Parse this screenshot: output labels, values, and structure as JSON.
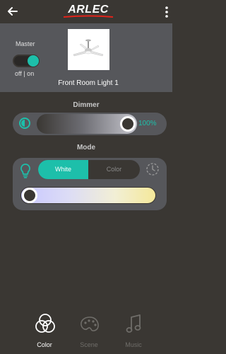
{
  "header": {
    "logo_text": "ARLEC",
    "back_icon": "arrow-left-icon",
    "more_icon": "more-vertical-icon",
    "brand_color": "#e2231a"
  },
  "device": {
    "master_label": "Master",
    "master_on": true,
    "offon_label": "off | on",
    "name": "Front Room Light 1"
  },
  "dimmer": {
    "title": "Dimmer",
    "value_text": "100%",
    "level": 1.0
  },
  "mode": {
    "title": "Mode",
    "options": [
      "White",
      "Color"
    ],
    "selected": "White",
    "accent": "#1dbfaa"
  },
  "tabs": [
    {
      "label": "Color",
      "icon": "color-circles-icon",
      "active": true
    },
    {
      "label": "Scene",
      "icon": "palette-icon",
      "active": false
    },
    {
      "label": "Music",
      "icon": "music-note-icon",
      "active": false
    }
  ]
}
